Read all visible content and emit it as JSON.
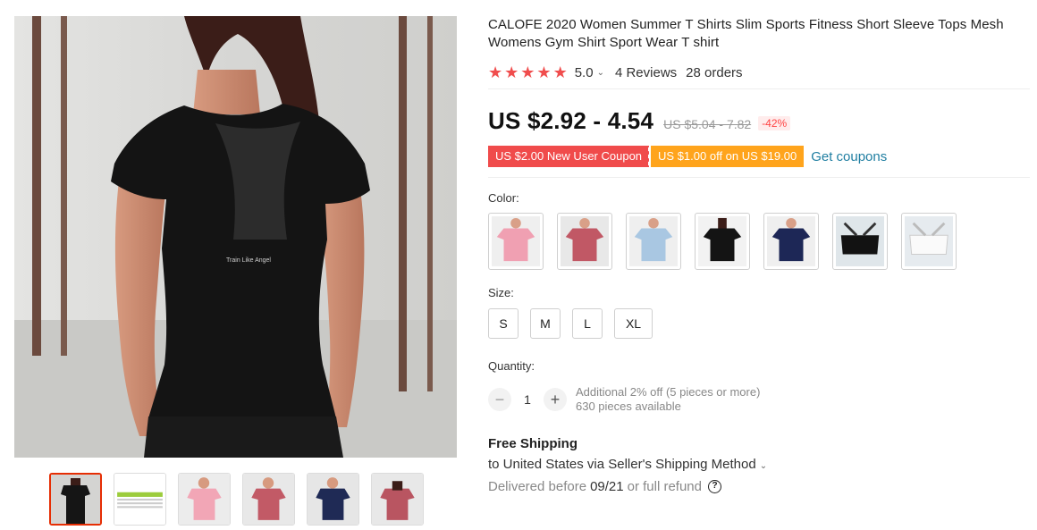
{
  "product": {
    "title": "CALOFE 2020 Women Summer T Shirts Slim Sports Fitness Short Sleeve Tops Mesh Womens Gym Shirt Sport Wear T shirt",
    "main_image_print": "Train Like Angel"
  },
  "rating": {
    "stars_icon": "★",
    "value": "5.0",
    "chevron": "⌄",
    "reviews": "4 Reviews",
    "orders": "28 orders"
  },
  "price": {
    "current": "US $2.92 - 4.54",
    "original": "US $5.04 - 7.82",
    "discount": "-42%"
  },
  "coupons": {
    "items": [
      "US $2.00 New User Coupon",
      "US $1.00 off on US $19.00"
    ],
    "link": "Get coupons"
  },
  "color": {
    "label": "Color:",
    "options": [
      "pink",
      "rose",
      "light-blue",
      "black",
      "navy",
      "black-bra-set",
      "white-bra-set"
    ]
  },
  "size": {
    "label": "Size:",
    "options": [
      "S",
      "M",
      "L",
      "XL"
    ]
  },
  "quantity": {
    "label": "Quantity:",
    "minus": "−",
    "value": "1",
    "plus": "+",
    "note_line1": "Additional 2% off (5 pieces or more)",
    "note_line2": "630 pieces available"
  },
  "shipping": {
    "title": "Free Shipping",
    "via": "to United States via Seller's Shipping Method",
    "chevron": "⌄",
    "deliver_prefix": "Delivered before",
    "deliver_date": "09/21",
    "deliver_suffix": "or full refund",
    "help_icon": "?"
  },
  "colors": {
    "accent_red": "#f04b4b",
    "coupon_orange": "#ffa41c",
    "link_blue": "#1f7ea1",
    "selected_thumb_border": "#e62e04"
  }
}
